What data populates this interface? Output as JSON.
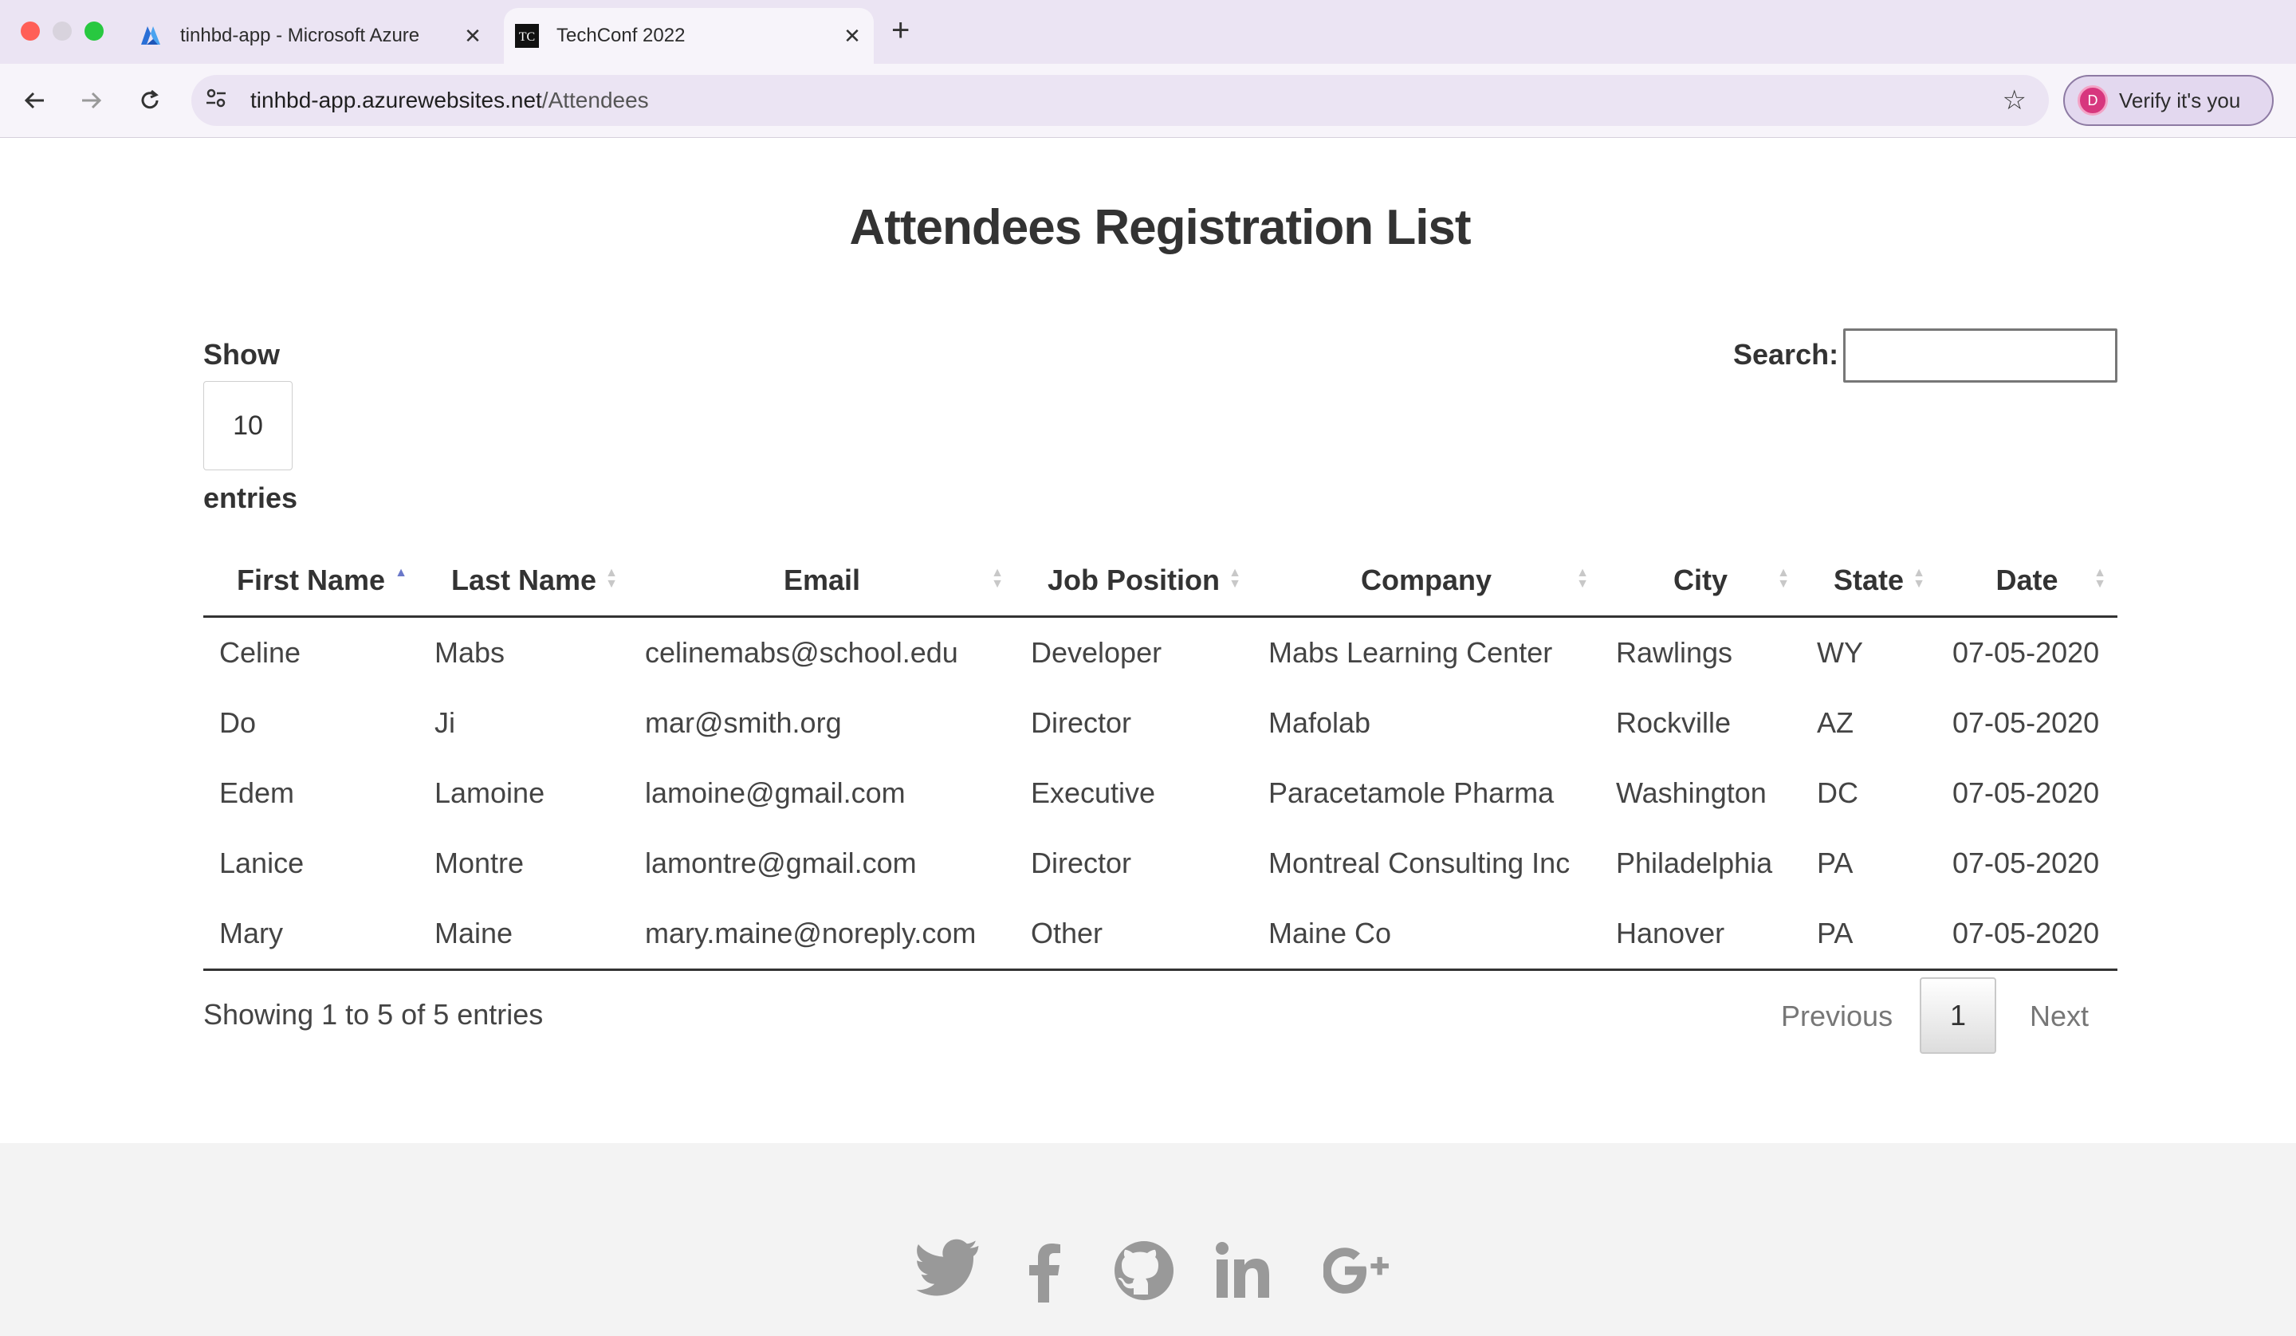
{
  "browser": {
    "tabs": [
      {
        "title": "tinhbd-app - Microsoft Azure",
        "favicon": "azure-icon"
      },
      {
        "title": "TechConf 2022",
        "favicon": "techconf-icon",
        "favicon_text": "TC"
      }
    ],
    "url_host": "tinhbd-app.azurewebsites.net",
    "url_path": "/Attendees",
    "verify_label": "Verify it's you",
    "avatar_letter": "D"
  },
  "page": {
    "title": "Attendees Registration List"
  },
  "controls": {
    "show_label": "Show",
    "page_length": "10",
    "entries_label": "entries",
    "search_label": "Search:",
    "search_value": ""
  },
  "table": {
    "columns": [
      "First Name",
      "Last Name",
      "Email",
      "Job Position",
      "Company",
      "City",
      "State",
      "Date"
    ],
    "sorted_column": "First Name",
    "rows": [
      [
        "Celine",
        "Mabs",
        "celinemabs@school.edu",
        "Developer",
        "Mabs Learning Center",
        "Rawlings",
        "WY",
        "07-05-2020"
      ],
      [
        "Do",
        "Ji",
        "mar@smith.org",
        "Director",
        "Mafolab",
        "Rockville",
        "AZ",
        "07-05-2020"
      ],
      [
        "Edem",
        "Lamoine",
        "lamoine@gmail.com",
        "Executive",
        "Paracetamole Pharma",
        "Washington",
        "DC",
        "07-05-2020"
      ],
      [
        "Lanice",
        "Montre",
        "lamontre@gmail.com",
        "Director",
        "Montreal Consulting Inc",
        "Philadelphia",
        "PA",
        "07-05-2020"
      ],
      [
        "Mary",
        "Maine",
        "mary.maine@noreply.com",
        "Other",
        "Maine Co",
        "Hanover",
        "PA",
        "07-05-2020"
      ]
    ]
  },
  "pagination": {
    "info": "Showing 1 to 5 of 5 entries",
    "previous": "Previous",
    "current_page": "1",
    "next": "Next"
  },
  "footer": {
    "social_icons": [
      "twitter-icon",
      "facebook-icon",
      "github-icon",
      "linkedin-icon",
      "google-plus-icon"
    ]
  },
  "colors": {
    "tabbar_bg": "#ebe4f3",
    "sort_active": "#6a78c9",
    "footer_bg": "#f3f3f3",
    "icon_gray": "#999999"
  }
}
